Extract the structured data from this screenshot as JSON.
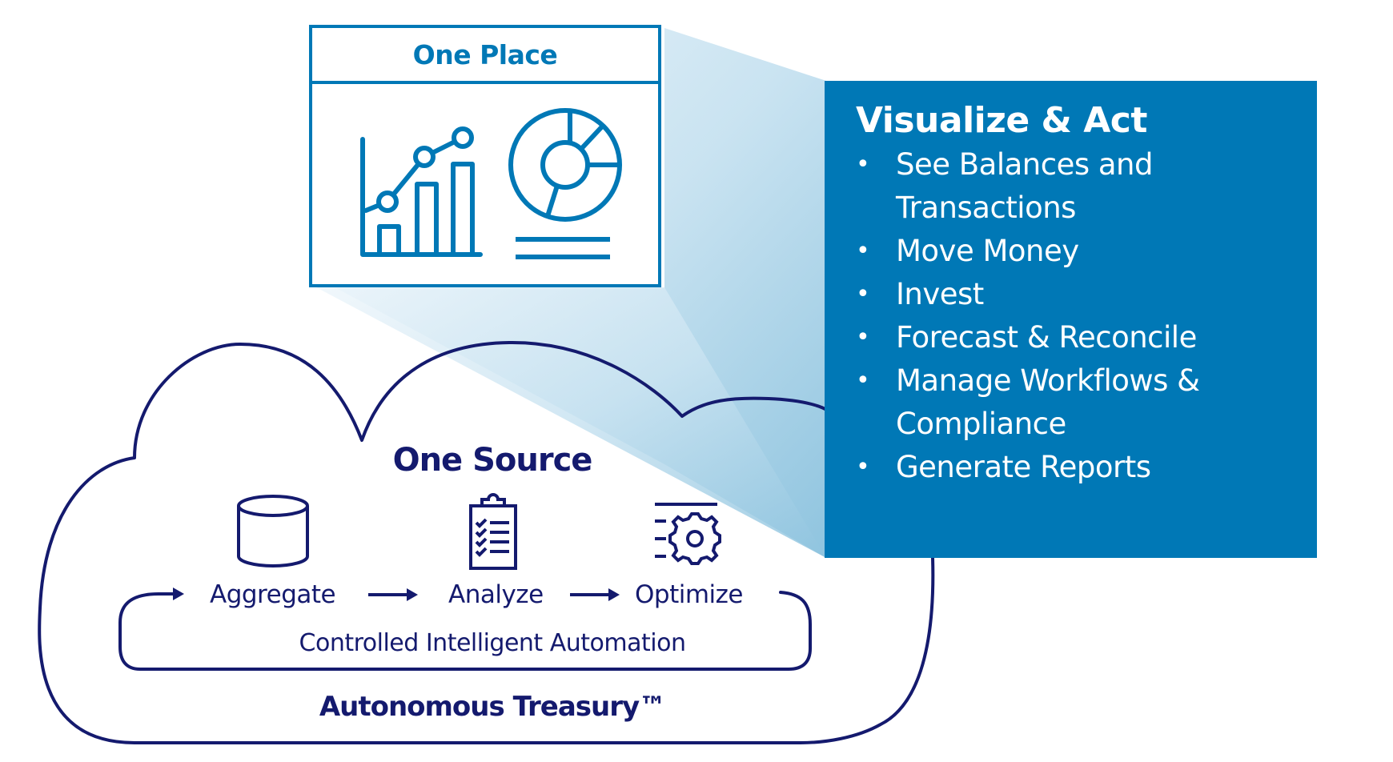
{
  "colors": {
    "primary_blue": "#0078b6",
    "navy": "#141a6e",
    "beam_light": "#e4f1f8",
    "beam_dark": "#9ccbe3",
    "white": "#ffffff"
  },
  "one_place": {
    "title": "One Place",
    "icons": [
      "bar-line-chart-icon",
      "donut-chart-icon",
      "legend-lines-icon"
    ]
  },
  "visualize_act": {
    "heading": "Visualize & Act",
    "items": [
      "See Balances and Transactions",
      "Move Money",
      "Invest",
      "Forecast & Reconcile",
      "Manage Workflows & Compliance",
      "Generate Reports"
    ]
  },
  "one_source": {
    "title": "One Source",
    "steps": [
      {
        "label": "Aggregate",
        "icon": "database-icon"
      },
      {
        "label": "Analyze",
        "icon": "clipboard-checklist-icon"
      },
      {
        "label": "Optimize",
        "icon": "gear-settings-icon"
      }
    ],
    "loop_label": "Controlled Intelligent Automation",
    "brand": "Autonomous Treasury™"
  }
}
